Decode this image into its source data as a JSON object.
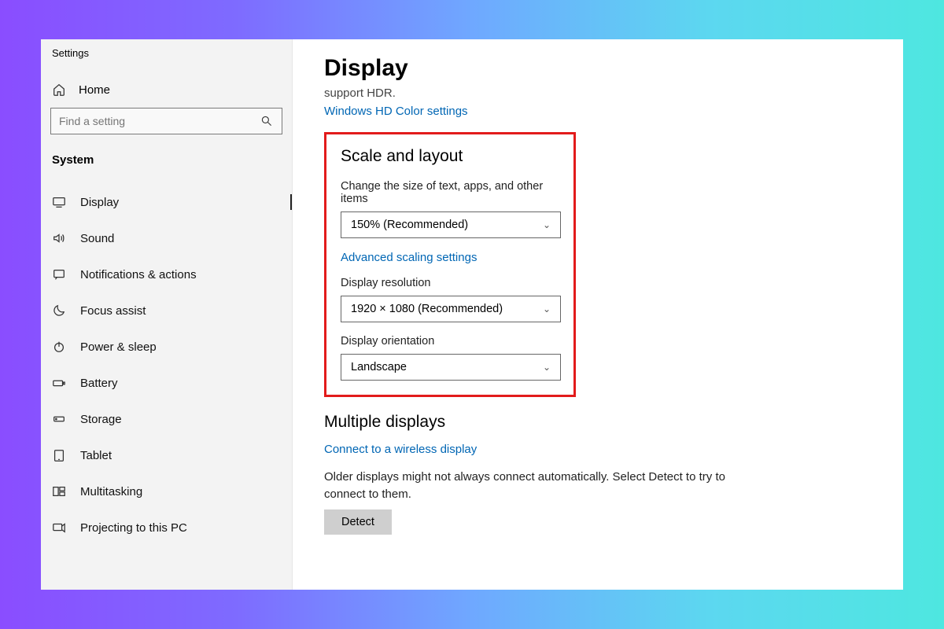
{
  "app": {
    "title": "Settings"
  },
  "sidebar": {
    "home": "Home",
    "search_placeholder": "Find a setting",
    "category": "System",
    "items": [
      {
        "label": "Display",
        "selected": true
      },
      {
        "label": "Sound"
      },
      {
        "label": "Notifications & actions"
      },
      {
        "label": "Focus assist"
      },
      {
        "label": "Power & sleep"
      },
      {
        "label": "Battery"
      },
      {
        "label": "Storage"
      },
      {
        "label": "Tablet"
      },
      {
        "label": "Multitasking"
      },
      {
        "label": "Projecting to this PC"
      }
    ]
  },
  "main": {
    "title": "Display",
    "hdr_text": "support HDR.",
    "hdr_link": "Windows HD Color settings",
    "scale": {
      "heading": "Scale and layout",
      "text_size_label": "Change the size of text, apps, and other items",
      "text_size_value": "150% (Recommended)",
      "advanced_link": "Advanced scaling settings",
      "resolution_label": "Display resolution",
      "resolution_value": "1920 × 1080 (Recommended)",
      "orientation_label": "Display orientation",
      "orientation_value": "Landscape"
    },
    "multiple": {
      "heading": "Multiple displays",
      "wireless_link": "Connect to a wireless display",
      "desc": "Older displays might not always connect automatically. Select Detect to try to connect to them.",
      "detect": "Detect"
    }
  }
}
